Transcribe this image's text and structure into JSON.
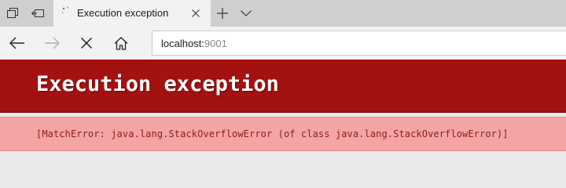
{
  "tab": {
    "title": "Execution exception"
  },
  "address_bar": {
    "host": "localhost:",
    "port": "9001"
  },
  "page": {
    "title": "Execution exception",
    "message": "[MatchError: java.lang.StackOverflowError (of class java.lang.StackOverflowError)]"
  },
  "colors": {
    "header_background": "#a31111",
    "message_band_background": "#f4a4a4",
    "message_text": "#8c1c1c"
  }
}
